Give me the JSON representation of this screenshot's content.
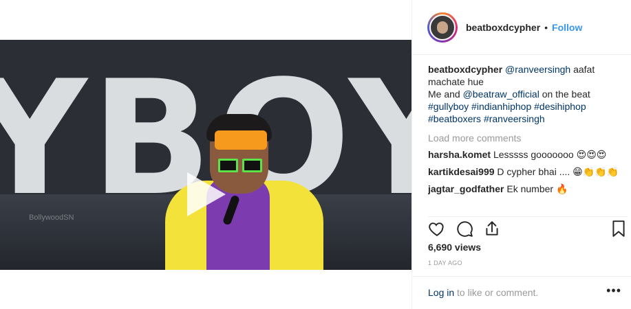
{
  "post": {
    "author": "beatboxdcypher",
    "separator": "•",
    "follow_label": "Follow"
  },
  "video": {
    "watermark": "BollywoodSN"
  },
  "caption": {
    "user": "beatboxdcypher",
    "mention1": "@ranveersingh",
    "text1": " aafat machate hue",
    "text2": "Me and ",
    "mention2": "@beatraw_official",
    "text3": " on the beat",
    "hashtags1": "#gullyboy #indianhiphop #desihiphop",
    "hashtags2": "#beatboxers #ranveersingh"
  },
  "load_more": "Load more comments",
  "comments": [
    {
      "user": "harsha.komet",
      "text": "Lesssss gooooooo",
      "emoji": "😍😍😍"
    },
    {
      "user": "kartikdesai999",
      "text": "D cypher bhai ....",
      "emoji": "😁👏👏👏"
    },
    {
      "user": "jagtar_godfather",
      "text": "Ek number",
      "emoji": "🔥"
    }
  ],
  "stats": {
    "views": "6,690 views",
    "posted": "1 DAY AGO"
  },
  "login": {
    "link": "Log in",
    "rest": " to like or comment."
  },
  "menu": "•••",
  "icons": [
    "heart-icon",
    "comment-icon",
    "share-icon",
    "bookmark-icon",
    "play-icon"
  ],
  "colors": {
    "accent": "#3897f0",
    "link": "#003569",
    "muted": "#999999"
  }
}
